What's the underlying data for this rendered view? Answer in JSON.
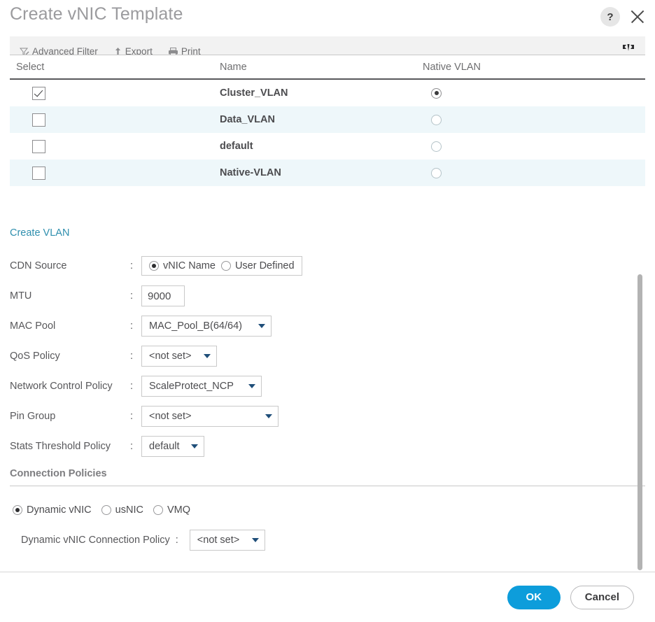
{
  "header": {
    "title": "Create vNIC Template",
    "help_icon": "help-icon",
    "help_label": "?",
    "close_icon": "close-icon"
  },
  "toolbar": {
    "advanced_filter": "Advanced Filter",
    "export": "Export",
    "print": "Print",
    "expand_icon": "expand-collapse-icon"
  },
  "table": {
    "columns": {
      "select": "Select",
      "name": "Name",
      "native_vlan": "Native VLAN"
    },
    "rows": [
      {
        "name": "Cluster_VLAN",
        "selected": true,
        "native": true
      },
      {
        "name": "Data_VLAN",
        "selected": false,
        "native": false
      },
      {
        "name": "default",
        "selected": false,
        "native": false
      },
      {
        "name": "Native-VLAN",
        "selected": false,
        "native": false
      }
    ]
  },
  "form": {
    "create_vlan_link": "Create VLAN",
    "cdn_source": {
      "label": "CDN Source",
      "colon": ":",
      "options": [
        "vNIC Name",
        "User Defined"
      ],
      "selected": "vNIC Name"
    },
    "mtu": {
      "label": "MTU",
      "colon": ":",
      "value": "9000"
    },
    "mac_pool": {
      "label": "MAC Pool",
      "colon": ":",
      "value": "MAC_Pool_B(64/64)"
    },
    "qos_policy": {
      "label": "QoS Policy",
      "colon": ":",
      "value": "<not set>"
    },
    "network_control_policy": {
      "label": "Network Control Policy",
      "colon": ":",
      "value": "ScaleProtect_NCP"
    },
    "pin_group": {
      "label": "Pin Group",
      "colon": ":",
      "value": "<not set>"
    },
    "stats_threshold_policy": {
      "label": "Stats Threshold Policy",
      "colon": ":",
      "value": "default"
    }
  },
  "connection_policies": {
    "section_title": "Connection Policies",
    "options": [
      "Dynamic vNIC",
      "usNIC",
      "VMQ"
    ],
    "selected": "Dynamic vNIC",
    "policy_label": "Dynamic vNIC Connection Policy",
    "policy_colon": ":",
    "policy_value": "<not set>"
  },
  "footer": {
    "ok_label": "OK",
    "cancel_label": "Cancel"
  },
  "colors": {
    "accent_blue": "#0d9ddb",
    "link_blue": "#2f8fae",
    "row_alt": "#eef7fa",
    "caret": "#1f4e79",
    "text": "#58585b"
  }
}
